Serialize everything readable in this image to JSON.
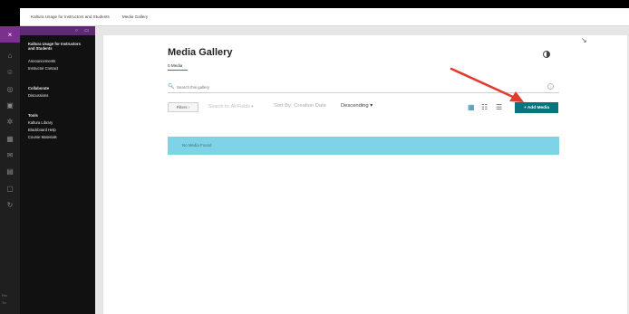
{
  "topbar": {
    "crumbs": [
      "Kaltura Usage for Instructors and Students",
      "Media Gallery"
    ]
  },
  "rail": {
    "close_glyph": "×",
    "icons": [
      "institution-icon",
      "profile-icon",
      "globe-icon",
      "courses-icon",
      "organizations-icon",
      "calendar-icon",
      "messages-icon",
      "grades-icon",
      "tools-icon",
      "signout-icon"
    ],
    "footer_lines": [
      "Priv",
      "Ter"
    ]
  },
  "menu": {
    "course_title": "Kaltura Usage for Instructors and Students",
    "items": [
      "Announcements",
      "Instructor Contact",
      "Collaborate",
      "Discussions",
      "Tools",
      "Kaltura Library",
      "Blackboard Help",
      "Course Materials"
    ]
  },
  "gallery": {
    "title": "Media Gallery",
    "media_count": "0 Media",
    "search_placeholder": "Search this gallery",
    "filters_label": "Filters ›",
    "search_in": "Search In: All Fields ▾",
    "sort_by": "Sort By: Creation Date",
    "sort_order": "Descending ▾",
    "add_media_label": "+ Add Media",
    "empty_message": "No Media Found"
  },
  "colors": {
    "accent": "#08747c",
    "banner": "#7ed4e6",
    "menu_purple": "#5e2a72",
    "arrow": "#e23b2e"
  }
}
